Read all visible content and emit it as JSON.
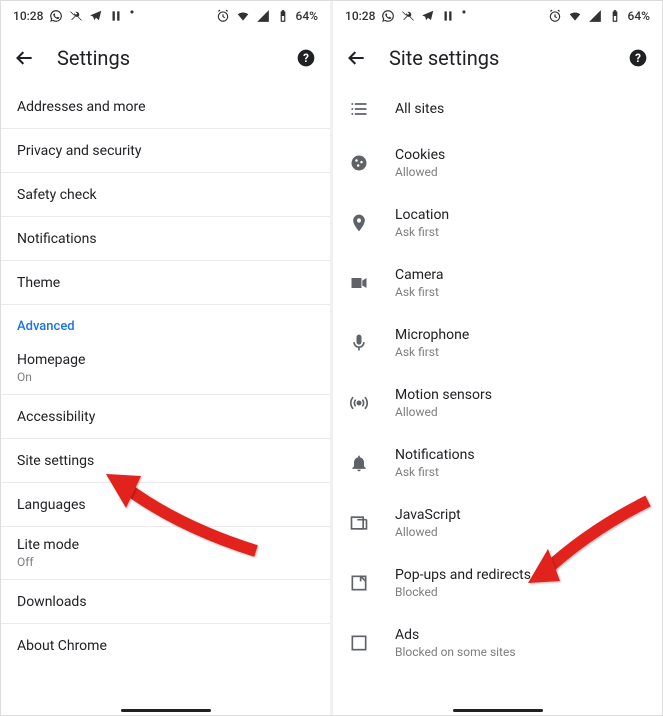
{
  "status": {
    "time": "10:28",
    "battery": "64%"
  },
  "left": {
    "title": "Settings",
    "rows": [
      {
        "label": "Addresses and more"
      },
      {
        "label": "Privacy and security"
      },
      {
        "label": "Safety check"
      },
      {
        "label": "Notifications"
      },
      {
        "label": "Theme"
      }
    ],
    "sectionHeader": "Advanced",
    "rows2": [
      {
        "label": "Homepage",
        "sub": "On"
      },
      {
        "label": "Accessibility"
      },
      {
        "label": "Site settings"
      },
      {
        "label": "Languages"
      },
      {
        "label": "Lite mode",
        "sub": "Off"
      },
      {
        "label": "Downloads"
      },
      {
        "label": "About Chrome"
      }
    ]
  },
  "right": {
    "title": "Site settings",
    "rows": [
      {
        "label": "All sites"
      },
      {
        "label": "Cookies",
        "sub": "Allowed"
      },
      {
        "label": "Location",
        "sub": "Ask first"
      },
      {
        "label": "Camera",
        "sub": "Ask first"
      },
      {
        "label": "Microphone",
        "sub": "Ask first"
      },
      {
        "label": "Motion sensors",
        "sub": "Allowed"
      },
      {
        "label": "Notifications",
        "sub": "Ask first"
      },
      {
        "label": "JavaScript",
        "sub": "Allowed"
      },
      {
        "label": "Pop-ups and redirects",
        "sub": "Blocked"
      },
      {
        "label": "Ads",
        "sub": "Blocked on some sites"
      }
    ]
  }
}
